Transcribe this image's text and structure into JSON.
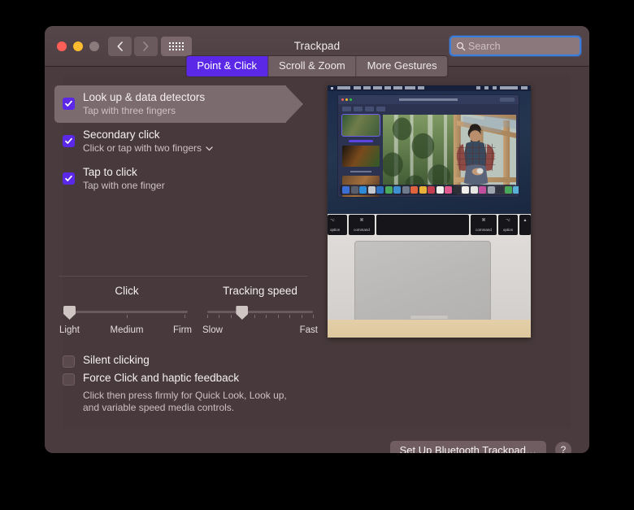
{
  "window": {
    "title": "Trackpad",
    "traffic_lights": [
      "close",
      "minimize",
      "zoom"
    ],
    "nav": {
      "back": "back-chevron",
      "forward": "forward-chevron",
      "grid": "show-all-grid"
    }
  },
  "search": {
    "placeholder": "Search",
    "value": "",
    "icon": "search-icon"
  },
  "tabs": [
    {
      "label": "Point & Click",
      "active": true
    },
    {
      "label": "Scroll & Zoom",
      "active": false
    },
    {
      "label": "More Gestures",
      "active": false
    }
  ],
  "options": [
    {
      "title": "Look up & data detectors",
      "subtitle": "Tap with three fingers",
      "checked": true,
      "highlighted": true,
      "has_popup": false
    },
    {
      "title": "Secondary click",
      "subtitle": "Click or tap with two fingers",
      "checked": true,
      "highlighted": false,
      "has_popup": true
    },
    {
      "title": "Tap to click",
      "subtitle": "Tap with one finger",
      "checked": true,
      "highlighted": false,
      "has_popup": false
    }
  ],
  "sliders": [
    {
      "label": "Click",
      "min_label": "Light",
      "mid_label": "Medium",
      "max_label": "Firm",
      "value_percent": 3,
      "ticks": 3
    },
    {
      "label": "Tracking speed",
      "min_label": "Slow",
      "max_label": "Fast",
      "value_percent": 33,
      "ticks": 10
    }
  ],
  "bottom_options": [
    {
      "label": "Silent clicking",
      "checked": false
    },
    {
      "label": "Force Click and haptic feedback",
      "checked": false
    }
  ],
  "force_click_description": "Click then press firmly for Quick Look, Look up, and variable speed media controls.",
  "footer": {
    "setup_button": "Set Up Bluetooth Trackpad…",
    "help_button": "?"
  },
  "preview": {
    "alt": "MacBook trackpad with desktop screenshot showing a photo of a man in a greenhouse"
  },
  "colors": {
    "accent": "#5b28e8",
    "window_bg": "#4a3c3e",
    "panel_bg": "#483a3c",
    "titlebar_bg": "#514346",
    "focus_ring": "#3a7fe0",
    "text_primary": "#f5f0f0",
    "text_secondary": "#cdc0c2",
    "highlight_row": "#7b6a6e"
  }
}
